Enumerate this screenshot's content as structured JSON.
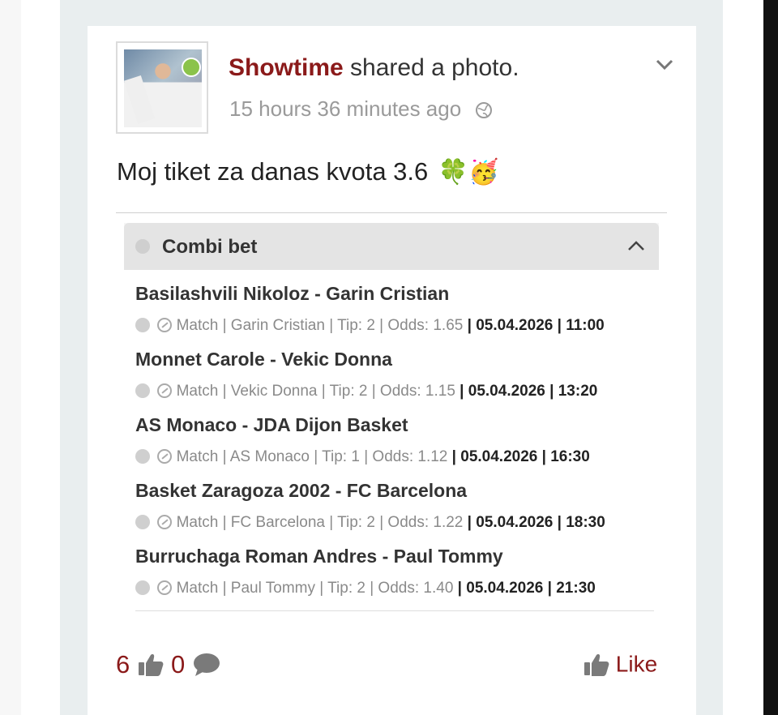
{
  "post": {
    "author": "Showtime",
    "action": "shared a photo.",
    "time": "15 hours 36 minutes ago",
    "text": "Moj tiket za danas kvota 3.6",
    "emojis": "🍀🥳"
  },
  "bet_slip": {
    "title": "Combi bet",
    "bets": [
      {
        "match": "Basilashvili Nikoloz - Garin Cristian",
        "sport_icon": "tennis-ball-icon",
        "details": "Match | Garin Cristian | Tip: 2 | Odds: 1.65",
        "datetime": "| 05.04.2026 | 11:00"
      },
      {
        "match": "Monnet Carole - Vekic Donna",
        "sport_icon": "tennis-ball-icon",
        "details": "Match | Vekic Donna | Tip: 2 | Odds: 1.15",
        "datetime": "| 05.04.2026 | 13:20"
      },
      {
        "match": "AS Monaco - JDA Dijon Basket",
        "sport_icon": "basketball-icon",
        "details": "Match | AS Monaco | Tip: 1 | Odds: 1.12",
        "datetime": "| 05.04.2026 | 16:30"
      },
      {
        "match": "Basket Zaragoza 2002 - FC Barcelona",
        "sport_icon": "basketball-icon",
        "details": "Match | FC Barcelona | Tip: 2 | Odds: 1.22",
        "datetime": "| 05.04.2026 | 18:30"
      },
      {
        "match": "Burruchaga Roman Andres - Paul Tommy",
        "sport_icon": "tennis-ball-icon",
        "details": "Match | Paul Tommy | Tip: 2 | Odds: 1.40",
        "datetime": "| 05.04.2026 | 21:30"
      }
    ]
  },
  "footer": {
    "likes": "6",
    "comments": "0",
    "like_label": "Like"
  },
  "colors": {
    "accent": "#8b1a1a",
    "online": "#8bc34a",
    "background": "#e9eeef"
  }
}
